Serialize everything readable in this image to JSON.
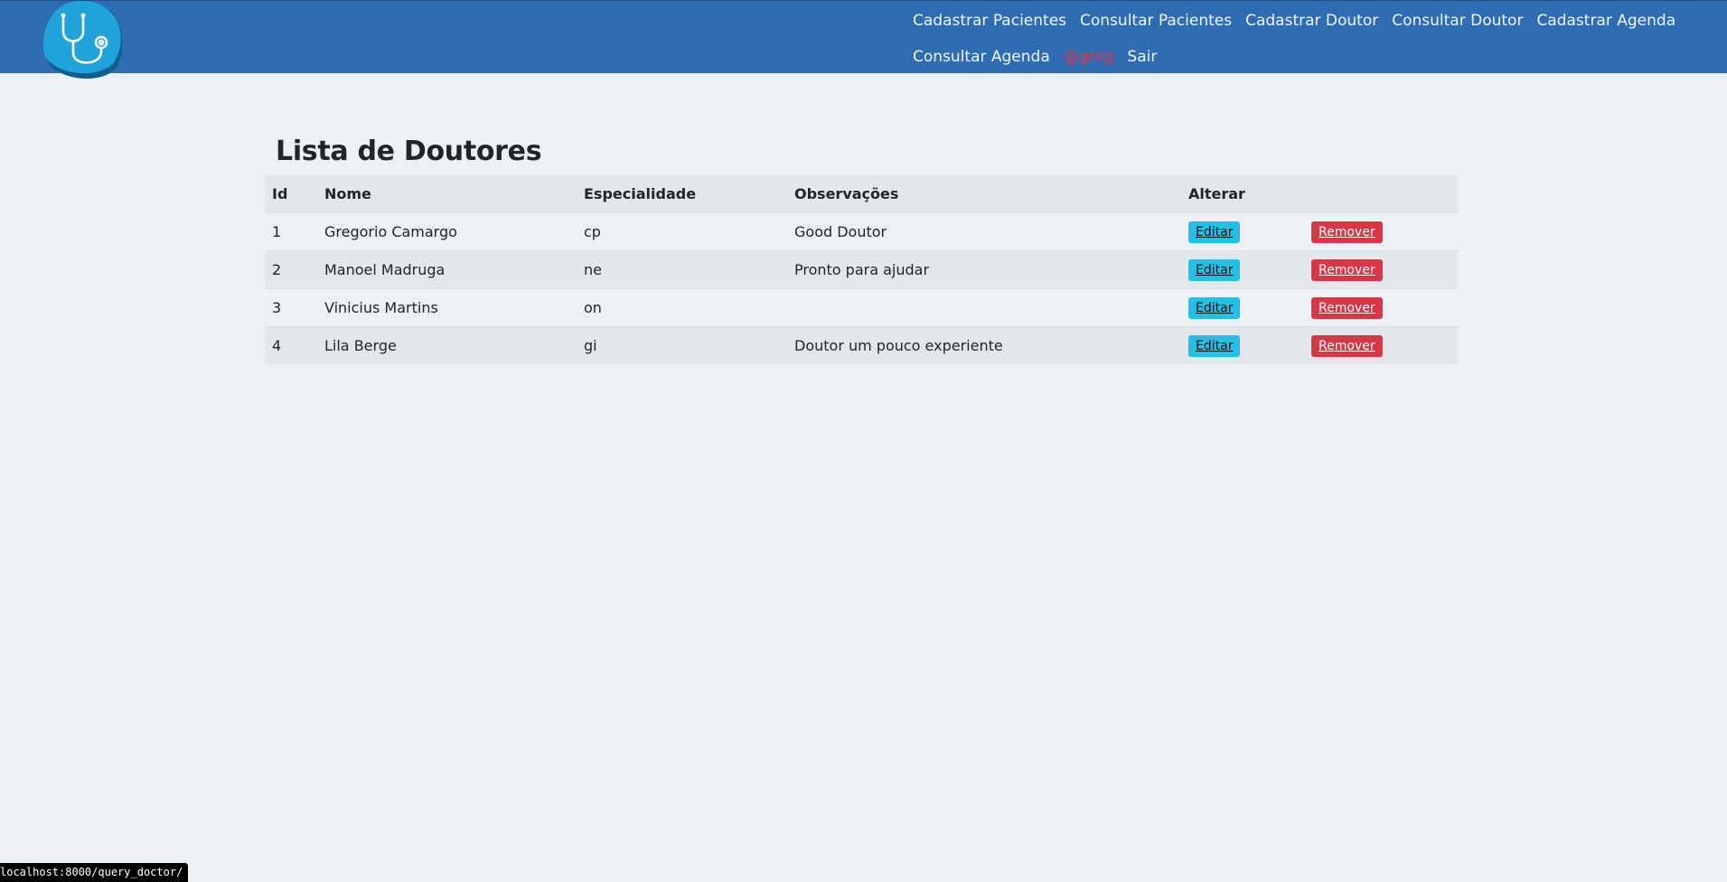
{
  "nav": {
    "row1": [
      "Cadastrar Pacientes",
      "Consultar Pacientes",
      "Cadastrar Doutor",
      "Consultar Doutor",
      "Cadastrar Agenda"
    ],
    "row2_link": "Consultar Agenda",
    "user": "@greg",
    "logout": "Sair",
    "logo_icon": "stethoscope-icon",
    "colors": {
      "navbar": "#2f6db2",
      "user": "#dc3545",
      "logo": "#1fa3d8"
    }
  },
  "page": {
    "title": "Lista de Doutores"
  },
  "table": {
    "headers": [
      "Id",
      "Nome",
      "Especialidade",
      "Observações",
      "Alterar",
      ""
    ],
    "rows": [
      {
        "id": "1",
        "nome": "Gregorio Camargo",
        "especialidade": "cp",
        "obs": "Good Doutor"
      },
      {
        "id": "2",
        "nome": "Manoel Madruga",
        "especialidade": "ne",
        "obs": "Pronto para ajudar"
      },
      {
        "id": "3",
        "nome": "Vinicius Martins",
        "especialidade": "on",
        "obs": ""
      },
      {
        "id": "4",
        "nome": "Lila Berge",
        "especialidade": "gi",
        "obs": "Doutor um pouco experiente"
      }
    ],
    "edit_label": "Editar",
    "remove_label": "Remover",
    "colors": {
      "edit": "#1fc1e6",
      "remove": "#dc3545"
    }
  },
  "status_bar": {
    "url": "localhost:8000/query_doctor/"
  }
}
